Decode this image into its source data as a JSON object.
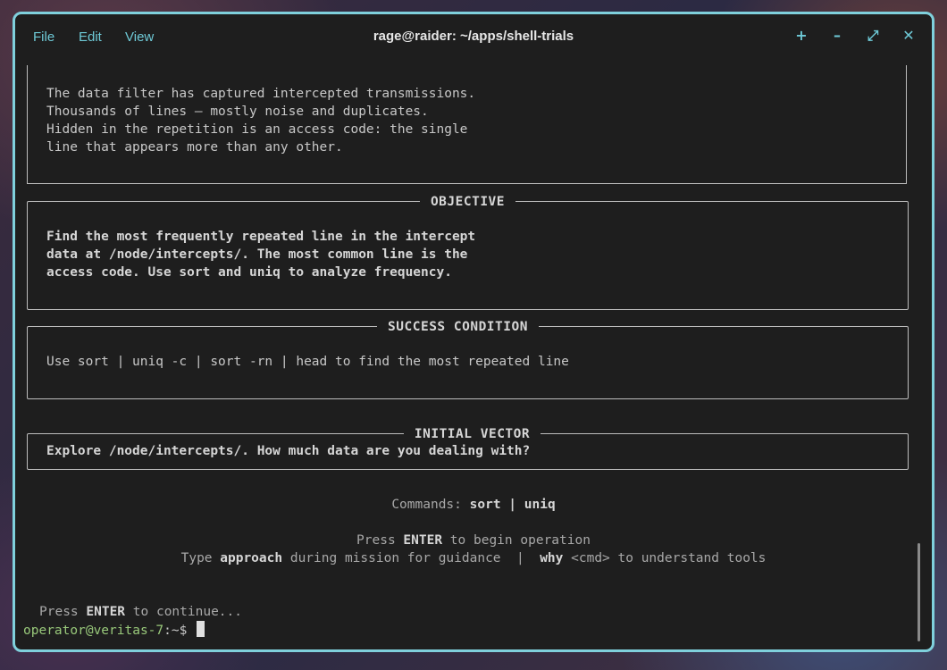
{
  "window": {
    "title": "rage@raider: ~/apps/shell-trials",
    "menu": [
      "File",
      "Edit",
      "View"
    ],
    "controls": {
      "add": "+",
      "minimize": "–",
      "maximize": "⤢",
      "close": "✕"
    }
  },
  "intro": {
    "lines": [
      "The data filter has captured intercepted transmissions.",
      "Thousands of lines — mostly noise and duplicates.",
      "Hidden in the repetition is an access code: the single",
      "line that appears more than any other."
    ]
  },
  "objective": {
    "title": "OBJECTIVE",
    "lines": [
      "Find the most frequently repeated line in the intercept",
      "data at /node/intercepts/. The most common line is the",
      "access code. Use sort and uniq to analyze frequency."
    ]
  },
  "success": {
    "title": "SUCCESS CONDITION",
    "line": "Use sort | uniq -c | sort -rn | head to find the most repeated line"
  },
  "vector": {
    "title": "INITIAL VECTOR",
    "line": "Explore /node/intercepts/. How much data are you dealing with?"
  },
  "commands": {
    "label": "Commands: ",
    "list": "sort | uniq"
  },
  "hints": {
    "press": "Press ",
    "enter": "ENTER",
    "begin": " to begin operation",
    "type": "Type ",
    "approach": "approach",
    "during": " during mission for guidance  |  ",
    "why": "why",
    "cmd": " <cmd> to understand tools"
  },
  "continue": {
    "press": "Press ",
    "enter": "ENTER",
    "rest": " to continue..."
  },
  "prompt": {
    "user": "operator@veritas-7",
    "rest": ":~$ "
  }
}
